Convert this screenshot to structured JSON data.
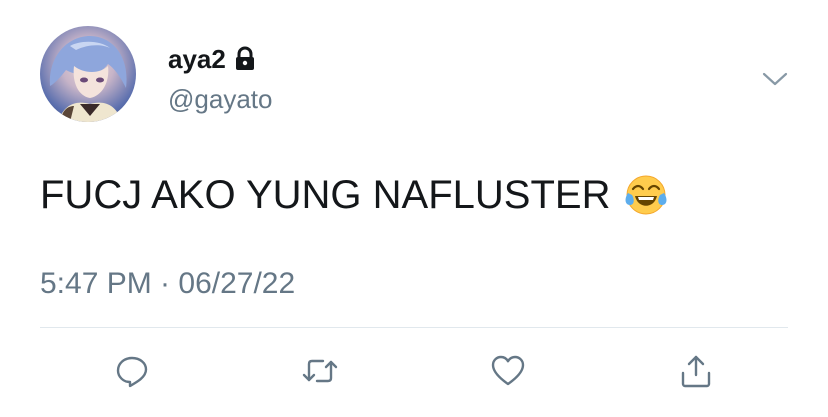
{
  "user": {
    "display_name": "aya2",
    "handle": "@gayato",
    "protected_icon": "lock-icon",
    "avatar": "avatar"
  },
  "tweet": {
    "text": "FUCJ AKO YUNG NAFLUSTER",
    "emoji": "face-with-tears-of-joy",
    "timestamp": "5:47 PM · 06/27/22"
  },
  "actions": [
    {
      "icon": "reply-icon"
    },
    {
      "icon": "retweet-icon"
    },
    {
      "icon": "like-icon"
    },
    {
      "icon": "share-icon"
    }
  ],
  "colors": {
    "text_primary": "#14171a",
    "text_secondary": "#657786",
    "divider": "#e1e8ed",
    "icon": "#657786"
  }
}
